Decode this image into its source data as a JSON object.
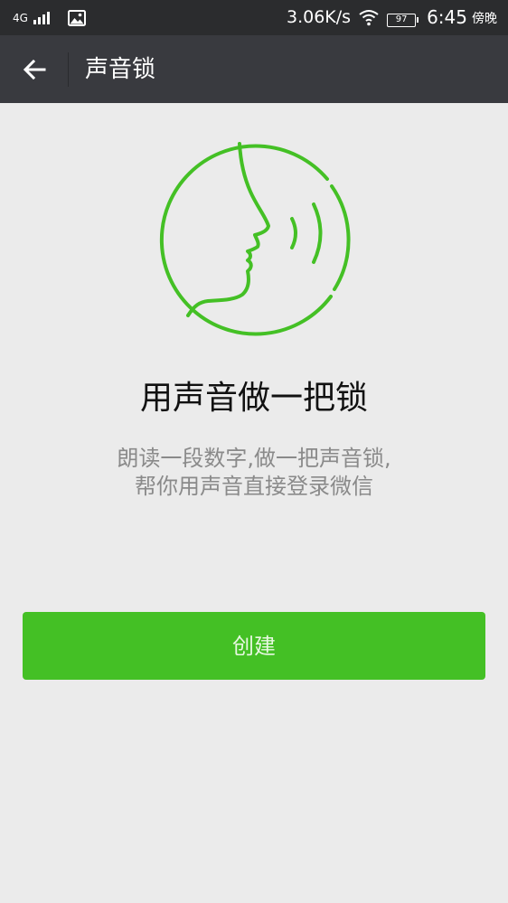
{
  "status_bar": {
    "network": "4G",
    "speed": "3.06K/s",
    "battery": "97",
    "time": "6:45",
    "period": "傍晚",
    "icons": [
      "signal-icon",
      "gallery-icon",
      "wifi-icon",
      "battery-icon"
    ]
  },
  "nav": {
    "title": "声音锁",
    "back_icon": "arrow-left-icon"
  },
  "main": {
    "illustration_icon": "face-voice-icon",
    "headline": "用声音做一把锁",
    "description_line1": "朗读一段数字,做一把声音锁,",
    "description_line2": "帮你用声音直接登录微信",
    "create_label": "创建"
  },
  "colors": {
    "status_bar_bg": "#2b2c2e",
    "nav_bar_bg": "#393a3f",
    "page_bg": "#ebebeb",
    "accent_green": "#44c025"
  }
}
